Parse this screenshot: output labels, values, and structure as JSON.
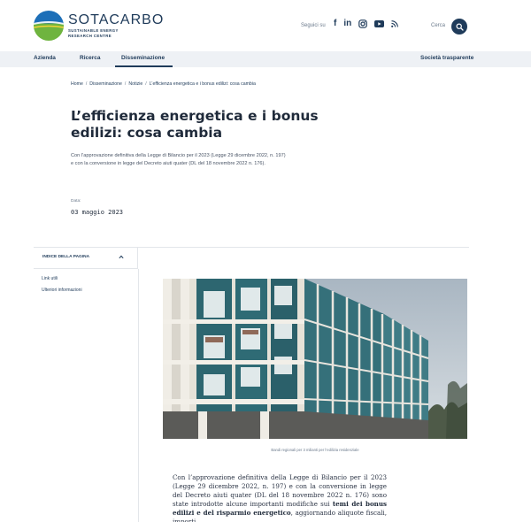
{
  "header": {
    "logo": {
      "name": "SOTACARBO",
      "sub_line1": "SUSTAINABLE ENERGY",
      "sub_line2": "RESEARCH CENTRE"
    },
    "social_label": "Seguici su",
    "social_icons": [
      "facebook-icon",
      "linkedin-icon",
      "instagram-icon",
      "youtube-icon",
      "rss-icon"
    ],
    "search_label": "Cerca"
  },
  "nav": {
    "items": [
      "Azienda",
      "Ricerca",
      "Disseminazione"
    ],
    "active": "Disseminazione",
    "right_item": "Società trasparente"
  },
  "breadcrumb": [
    "Home",
    "Disseminazione",
    "Notizie",
    "L’efficienza energetica e i bonus edilizi: cosa cambia"
  ],
  "article": {
    "title": "L’efficienza energetica e i bonus edilizi: cosa cambia",
    "lead": "Con l’approvazione definitiva della Legge di Bilancio per il 2023 (Legge 29 dicembre 2022, n. 197) e con la conversione in legge del Decreto aiuti quater (DL del 18 novembre 2022 n. 176).",
    "date_label": "Data:",
    "date_value": "03 maggio 2023",
    "image_caption": "Bandi regionali per 3 milianti per l’edilizia residenziale",
    "body_part1": "Con l’approvazione definitiva della Legge di Bilancio per il 2023 (Legge 29 dicembre 2022, n. 197) e con la conversione in legge del Decreto aiuti quater (DL del 18 novembre 2022 n. 176) sono state introdotte alcune importanti modifiche sui ",
    "body_bold": "temi dei bonus edilizi e del risparmio energetico",
    "body_part2": ", aggiornando aliquote fiscali, importi,"
  },
  "toc": {
    "heading": "INDICE DELLA PAGINA",
    "items": [
      "Link utili",
      "Ulteriori informazioni"
    ]
  },
  "colors": {
    "brand_navy": "#1f3b5a",
    "brand_blue": "#1d6fb8",
    "brand_green": "#6fb43f",
    "nav_bg": "#eef1f5"
  }
}
